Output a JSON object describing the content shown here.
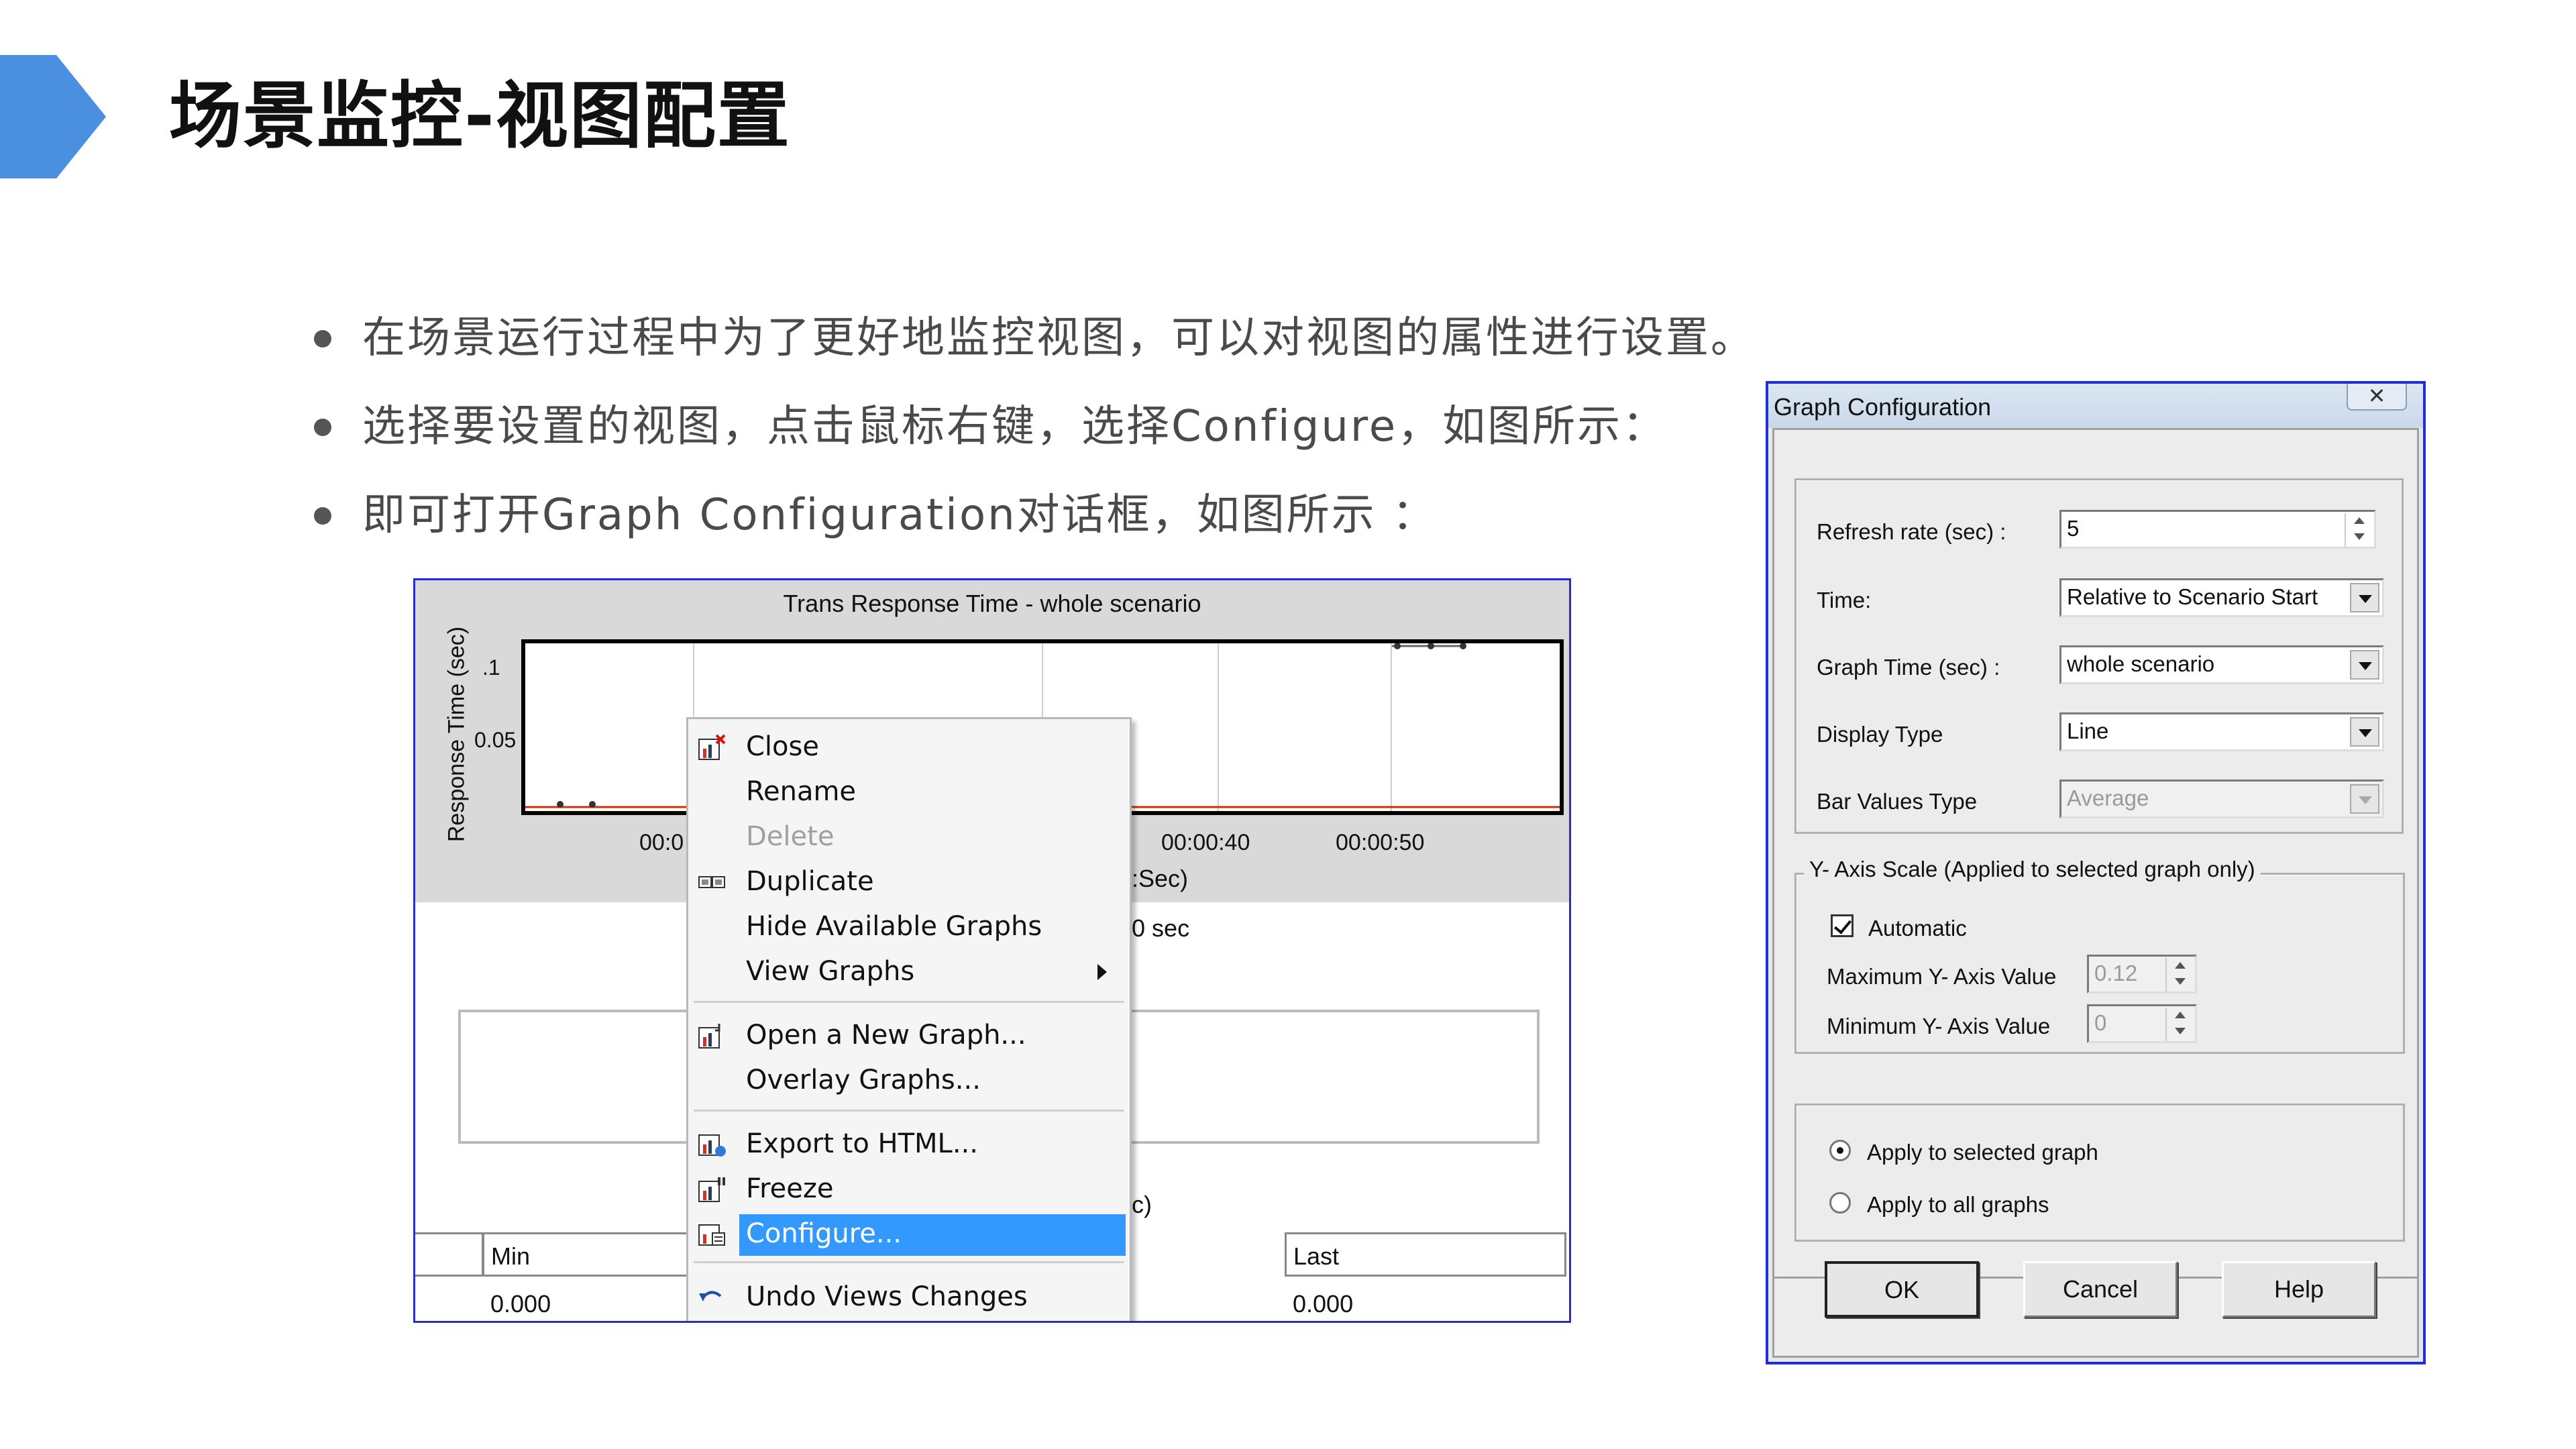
{
  "slide": {
    "title": "场景监控-视图配置",
    "accent_color": "#4a8fe0",
    "bullets": [
      "在场景运行过程中为了更好地监控视图，可以对视图的属性进行设置。",
      "选择要设置的视图，点击鼠标右键，选择Configure，如图所示：",
      "即可打开Graph Configuration对话框，如图所示 ："
    ]
  },
  "graph_window": {
    "title": "Trans Response Time - whole scenario",
    "y_axis_label": "Response Time (sec)",
    "y_ticks": [
      ".1",
      "0.05"
    ],
    "x_ticks": [
      "00:0",
      "00:00:40",
      "00:00:50"
    ],
    "x_axis_label_fragment": "n:Sec)",
    "period_fragment": "60 sec",
    "sec_fragment": "ec)",
    "table": {
      "headers": [
        "Min",
        "Last"
      ],
      "values": [
        "0.000",
        "0.000"
      ]
    }
  },
  "context_menu": {
    "items": [
      {
        "label": "Close",
        "icon": "close-graph-icon",
        "disabled": false
      },
      {
        "label": "Rename",
        "icon": "",
        "disabled": false
      },
      {
        "label": "Delete",
        "icon": "",
        "disabled": true
      },
      {
        "label": "Duplicate",
        "icon": "duplicate-icon",
        "disabled": false
      },
      {
        "label": "Hide Available Graphs",
        "icon": "",
        "disabled": false
      },
      {
        "label": "View Graphs",
        "icon": "",
        "disabled": false,
        "submenu": true
      },
      {
        "label": "Open a New Graph...",
        "icon": "open-graph-icon",
        "disabled": false
      },
      {
        "label": "Overlay Graphs...",
        "icon": "",
        "disabled": false
      },
      {
        "label": "Export to HTML...",
        "icon": "export-html-icon",
        "disabled": false
      },
      {
        "label": "Freeze",
        "icon": "freeze-icon",
        "disabled": false
      },
      {
        "label": "Configure...",
        "icon": "configure-icon",
        "disabled": false,
        "selected": true
      },
      {
        "label": "Undo Views Changes",
        "icon": "undo-icon",
        "disabled": false
      }
    ],
    "highlight_color": "#3399ff"
  },
  "dialog": {
    "title": "Graph Configuration",
    "close_glyph": "✕",
    "refresh_rate": {
      "label": "Refresh rate (sec) :",
      "value": "5"
    },
    "time": {
      "label": "Time:",
      "value": "Relative to Scenario Start"
    },
    "graph_time": {
      "label": "Graph Time (sec) :",
      "value": "whole scenario"
    },
    "display_type": {
      "label": "Display Type",
      "value": "Line"
    },
    "bar_values_type": {
      "label": "Bar Values Type",
      "value": "Average"
    },
    "y_axis_group": {
      "legend": "Y- Axis Scale (Applied to selected graph only)",
      "automatic_label": "Automatic",
      "automatic_checked": true,
      "max_label": "Maximum Y- Axis Value",
      "max_value": "0.12",
      "min_label": "Minimum  Y- Axis Value",
      "min_value": "0"
    },
    "apply_group": {
      "selected_label": "Apply to selected graph",
      "all_label": "Apply to all graphs",
      "selected_checked": true
    },
    "buttons": {
      "ok": "OK",
      "cancel": "Cancel",
      "help": "Help"
    }
  }
}
